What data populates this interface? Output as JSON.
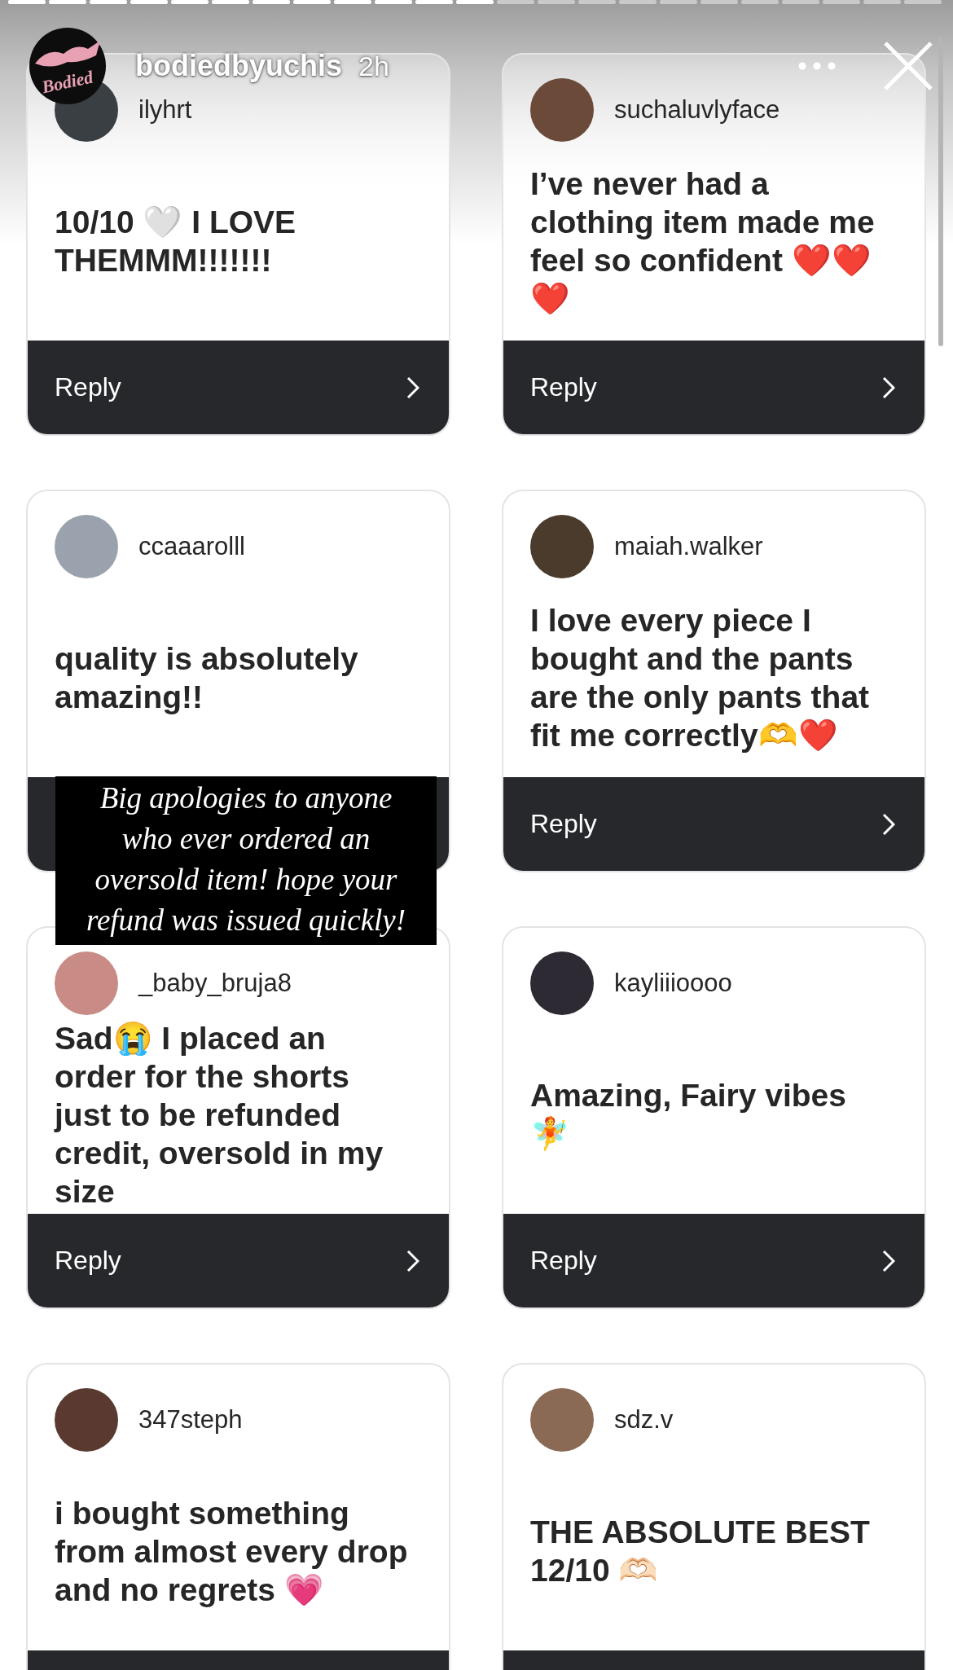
{
  "story_header": {
    "logo_text": "Bodied",
    "username": "bodiedbyuchis",
    "time": "2h"
  },
  "cards": [
    {
      "username": "ilyhrt",
      "comment": "10/10 🤍 I LOVE THEMMM!!!!!!!",
      "reply": "Reply"
    },
    {
      "username": "suchaluvlyface",
      "comment": "I’ve never had a clothing item made me feel so confident ❤️❤️❤️",
      "reply": "Reply"
    },
    {
      "username": "ccaaarolll",
      "comment": "quality is absolutely amazing!!"
    },
    {
      "username": "maiah.walker",
      "comment": "I love every piece I bought and the pants are the only pants that fit me correctly🫶❤️",
      "reply": "Reply"
    },
    {
      "username": "_baby_bruja8",
      "comment": "Sad😭 I placed an order for the shorts just to be refunded credit, oversold in my size",
      "reply": "Reply"
    },
    {
      "username": "kayliiioooo",
      "comment": "Amazing, Fairy vibes 🧚",
      "reply": "Reply"
    },
    {
      "username": "347steph",
      "comment": "i bought something from almost every drop and no regrets 💗"
    },
    {
      "username": "sdz.v",
      "comment": "THE ABSOLUTE BEST 12/10 🫶🏻"
    }
  ],
  "caption": "Big apologies to anyone who ever ordered an oversold item! hope your refund was issued quickly!"
}
